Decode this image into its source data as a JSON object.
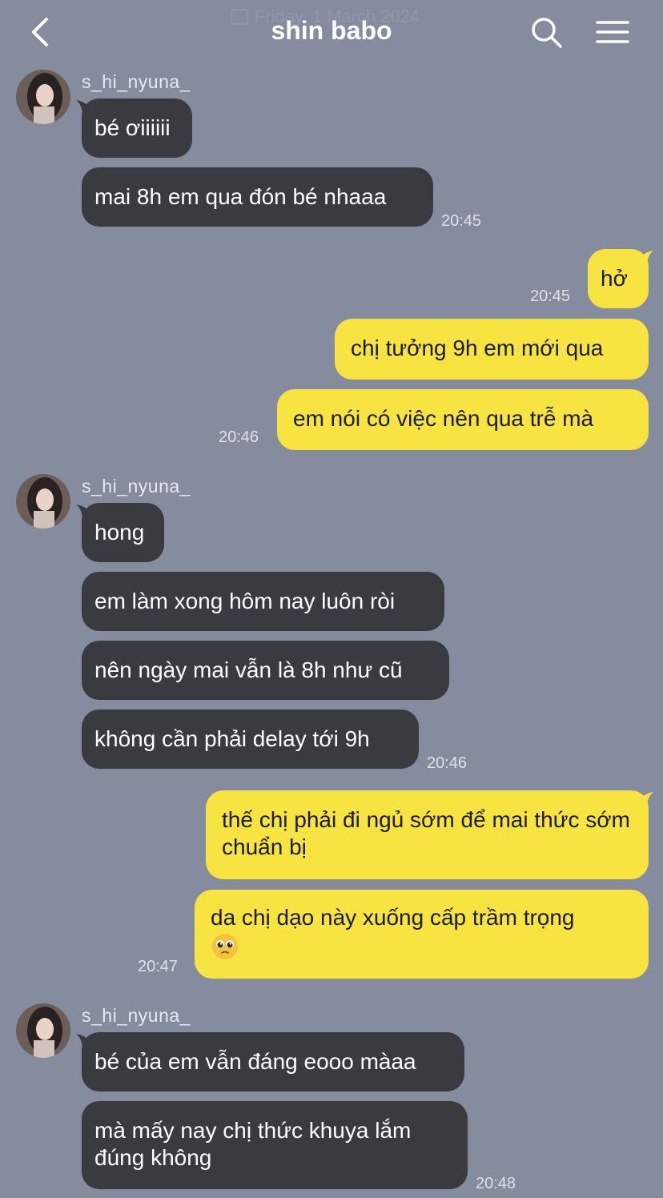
{
  "header": {
    "date": "Friday, 1 March 2024",
    "title": "shin babo"
  },
  "messages": {
    "g1": {
      "sender": "s_hi_nyuna_",
      "m1": "bé ơiiiiii",
      "m2": "mai 8h em qua đón bé nhaaa",
      "time": "20:45"
    },
    "o1": {
      "m1": "hở",
      "time1": "20:45",
      "m2": "chị tưởng 9h em mới qua",
      "m3": "em nói có việc nên qua trễ mà",
      "time3": "20:46"
    },
    "g2": {
      "sender": "s_hi_nyuna_",
      "m1": "hong",
      "m2": "em làm xong hôm nay luôn ròi",
      "m3": "nên ngày mai vẫn là 8h như cũ",
      "m4": "không cần phải delay tới 9h",
      "time": "20:46"
    },
    "o2": {
      "m1": "thế chị phải đi ngủ sớm để mai thức sớm chuẩn bị",
      "m2": "da chị dạo này xuống cấp trầm trọng",
      "time": "20:47"
    },
    "g3": {
      "sender": "s_hi_nyuna_",
      "m1": "bé của em vẫn đáng eooo màaa",
      "m2": "mà mấy nay chị thức khuya lắm đúng không",
      "time": "20:48"
    }
  },
  "icons": {
    "back": "chevron-left-icon",
    "search": "search-icon",
    "menu": "hamburger-menu-icon",
    "emoji": "pleading-face-emoji"
  },
  "colors": {
    "background": "#858c9d",
    "incoming_bubble": "#3a3b40",
    "outgoing_bubble": "#f7e441"
  }
}
